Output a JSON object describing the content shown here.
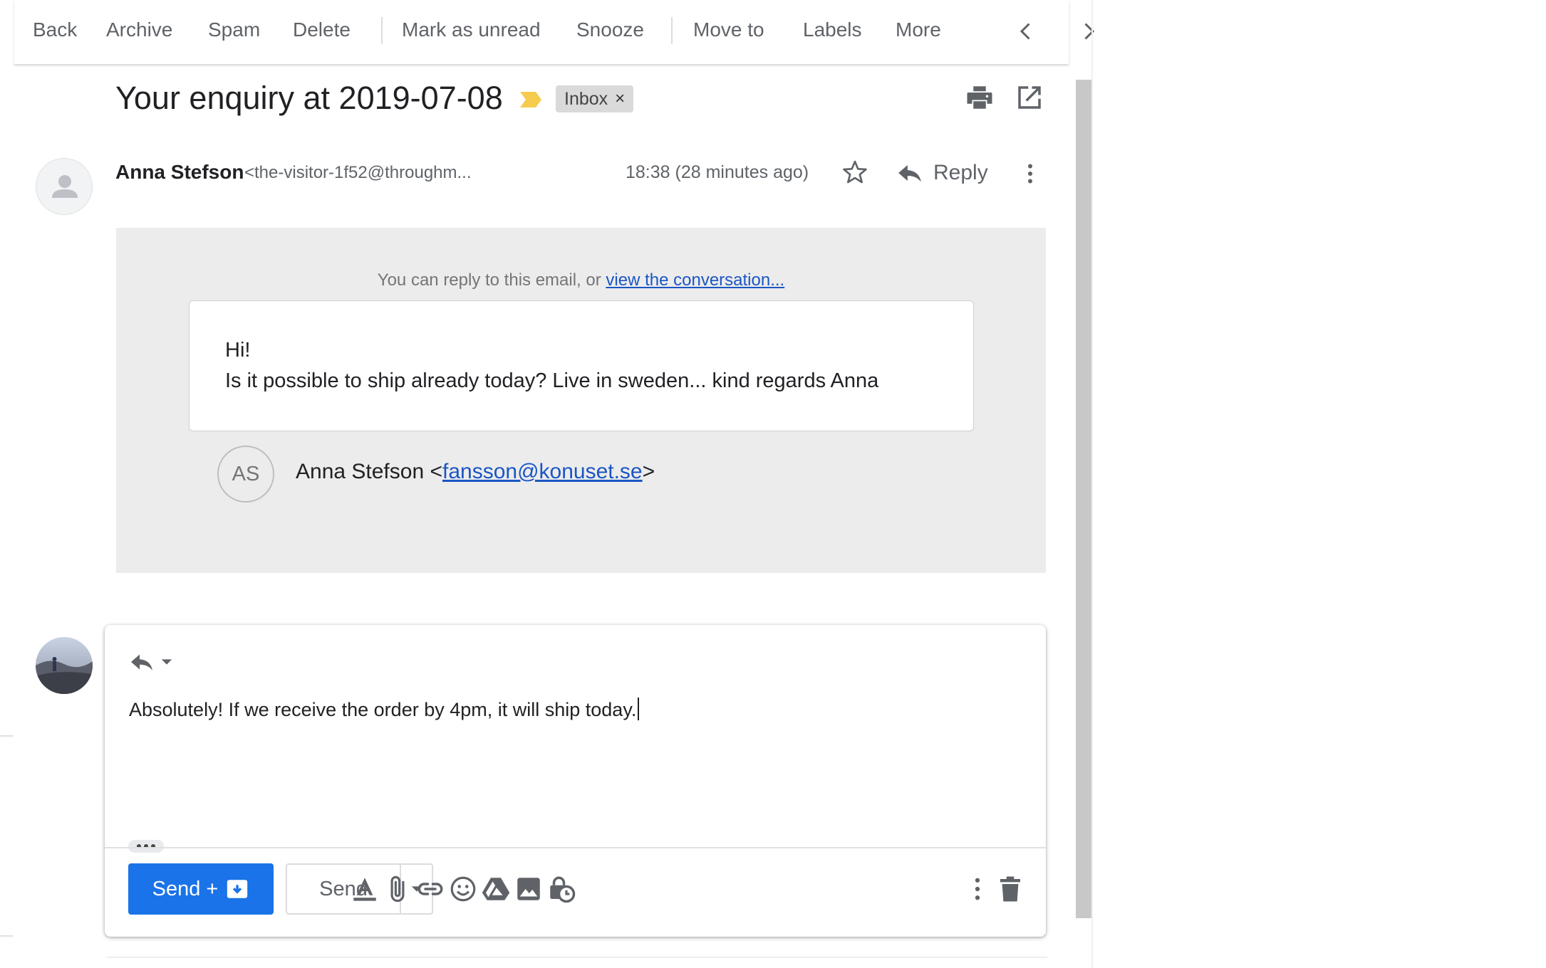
{
  "toolbar": {
    "back": "Back",
    "archive": "Archive",
    "spam": "Spam",
    "delete": "Delete",
    "mark_unread": "Mark as unread",
    "snooze": "Snooze",
    "move_to": "Move to",
    "labels": "Labels",
    "more": "More",
    "prev_icon": "chevron-left-icon",
    "next_icon": "chevron-right-icon"
  },
  "thread": {
    "subject": "Your enquiry at 2019-07-08",
    "label_chip": "Inbox",
    "chip_close": "×",
    "print_icon": "print-icon",
    "open_new_icon": "open-in-new-window-icon"
  },
  "message": {
    "sender_name": "Anna Stefson",
    "sender_email": "<the-visitor-1f52@throughm...",
    "time": "18:38 (28 minutes ago)",
    "reply_label": "Reply",
    "reply_note": "You can reply to this email, or",
    "reply_note_link": "view the conversation...",
    "body_line1": "Hi!",
    "body_line2": "Is it possible to ship already today? Live in sweden... kind regards Anna",
    "sig_initials": "AS",
    "sig_name_prefix": "Anna Stefson <",
    "sig_email": "fansson@konuset.se",
    "sig_suffix": ">"
  },
  "compose": {
    "draft_text": "Absolutely! If we receive the order by 4pm, it will ship today.",
    "send_archive_label": "Send +",
    "send_label": "Send"
  },
  "colors": {
    "accent": "#1a73e8",
    "link": "#1a56c4",
    "importance_marker": "#f7cb4d"
  }
}
